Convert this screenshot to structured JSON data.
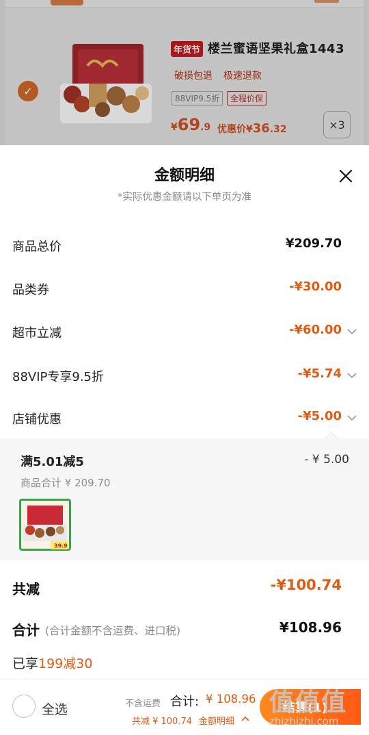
{
  "background_item": {
    "tag": "年货节",
    "title": "楼兰蜜语坚果礼盒1443",
    "services": [
      "破损包退",
      "极速退款"
    ],
    "badges": [
      "88VIP9.5折",
      "全程价保"
    ],
    "price_currency": "¥",
    "price_int": "69",
    "price_dec": ".9",
    "promo_label": "优惠价¥",
    "promo_int": "36",
    "promo_dec": ".32",
    "quantity": "×3"
  },
  "sheet": {
    "title": "金额明细",
    "subtitle": "*实际优惠金额请以下单页为准"
  },
  "lines": [
    {
      "label": "商品总价",
      "value": "¥209.70"
    },
    {
      "label": "品类券",
      "value": "-¥30.00"
    },
    {
      "label": "超市立减",
      "value": "-¥60.00"
    },
    {
      "label": "88VIP专享9.5折",
      "value": "-¥5.74"
    },
    {
      "label": "店铺优惠",
      "value": "-¥5.00"
    }
  ],
  "detail": {
    "title": "满5.01减5",
    "amount": "- ¥ 5.00",
    "subtotal": "商品合计 ¥ 209.70",
    "thumb_price": "39.9"
  },
  "total_reduce": {
    "label": "共减",
    "value": "-¥100.74"
  },
  "sum": {
    "label": "合计",
    "note": "(合计金额不含运费、进口税)",
    "value": "¥108.96"
  },
  "enjoy": {
    "prefix": "已享",
    "highlight": "199减30"
  },
  "bottom": {
    "select_all": "全选",
    "no_shipping": "不含运费",
    "total_label": "合计:",
    "total_value": "¥ 108.96",
    "saved": "共减 ¥ 100.74",
    "detail_link": "金额明细",
    "checkout": "结算(1)"
  },
  "watermark": {
    "logo": "值值值",
    "url": "zhizhizhi.com"
  },
  "colors": {
    "accent": "#e25b12",
    "checkout_start": "#ff8a1e",
    "checkout_end": "#ff5a14",
    "detail_bg": "#f7f7f7"
  }
}
